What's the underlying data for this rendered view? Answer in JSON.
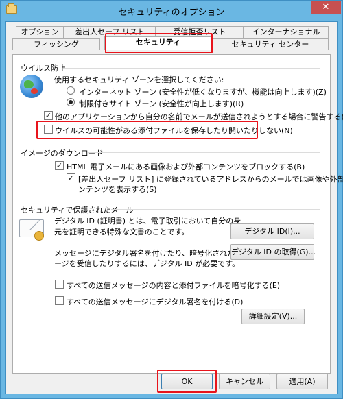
{
  "window": {
    "title": "セキュリティのオプション",
    "close_glyph": "✕"
  },
  "tabs": {
    "row1": [
      "オプション",
      "差出人セーフ リスト",
      "受信拒否リスト",
      "インターナショナル"
    ],
    "row2": [
      "フィッシング",
      "セキュリティ",
      "セキュリティ センター"
    ],
    "selected": "セキュリティ"
  },
  "virus": {
    "group_title": "ウイルス防止",
    "zone_prompt": "使用するセキュリティ ゾーンを選択してください:",
    "radio_internet": "インターネット ゾーン (安全性が低くなりますが、機能は向上します)(Z)",
    "radio_restricted": "制限付きサイト ゾーン (安全性が向上します)(R)",
    "selected_zone": "制限付きサイト ゾーン",
    "warn_label": "他のアプリケーションから自分の名前でメールが送信されようとする場合に警告する(W)",
    "warn_checked": true,
    "block_attach_label": "ウイルスの可能性がある添付ファイルを保存したり開いたりしない(N)",
    "block_attach_checked": false
  },
  "images": {
    "group_title": "イメージのダウンロード",
    "block_label": "HTML 電子メールにある画像および外部コンテンツをブロックする(B)",
    "block_checked": true,
    "safe_list_label_line1": "[差出人セーフ リスト] に登録されているアドレスからのメールでは画像や外部コ",
    "safe_list_label_line2": "ンテンツを表示する(S)",
    "safe_list_checked": true
  },
  "secure_mail": {
    "group_title": "セキュリティで保護されたメール",
    "id_desc_line1": "デジタル ID (証明書) とは、電子取引において自分の身",
    "id_desc_line2": "元を証明できる特殊な文書のことです。",
    "digital_id_button": "デジタル ID(I)...",
    "sign_desc_line1": "メッセージにデジタル署名を付けたり、暗号化されたメッセ",
    "sign_desc_line2": "ージを受信したりするには、デジタル ID が必要です。",
    "get_id_button": "デジタル ID の取得(G)...",
    "encrypt_label": "すべての送信メッセージの内容と添付ファイルを暗号化する(E)",
    "encrypt_checked": false,
    "sign_label": "すべての送信メッセージにデジタル署名を付ける(D)",
    "sign_checked": false,
    "advanced_button": "詳細設定(V)..."
  },
  "footer": {
    "ok": "OK",
    "cancel": "キャンセル",
    "apply": "適用(A)"
  },
  "colors": {
    "title_bar": "#6ab7e3",
    "close_button": "#c75050",
    "highlight": "#e8141c"
  }
}
